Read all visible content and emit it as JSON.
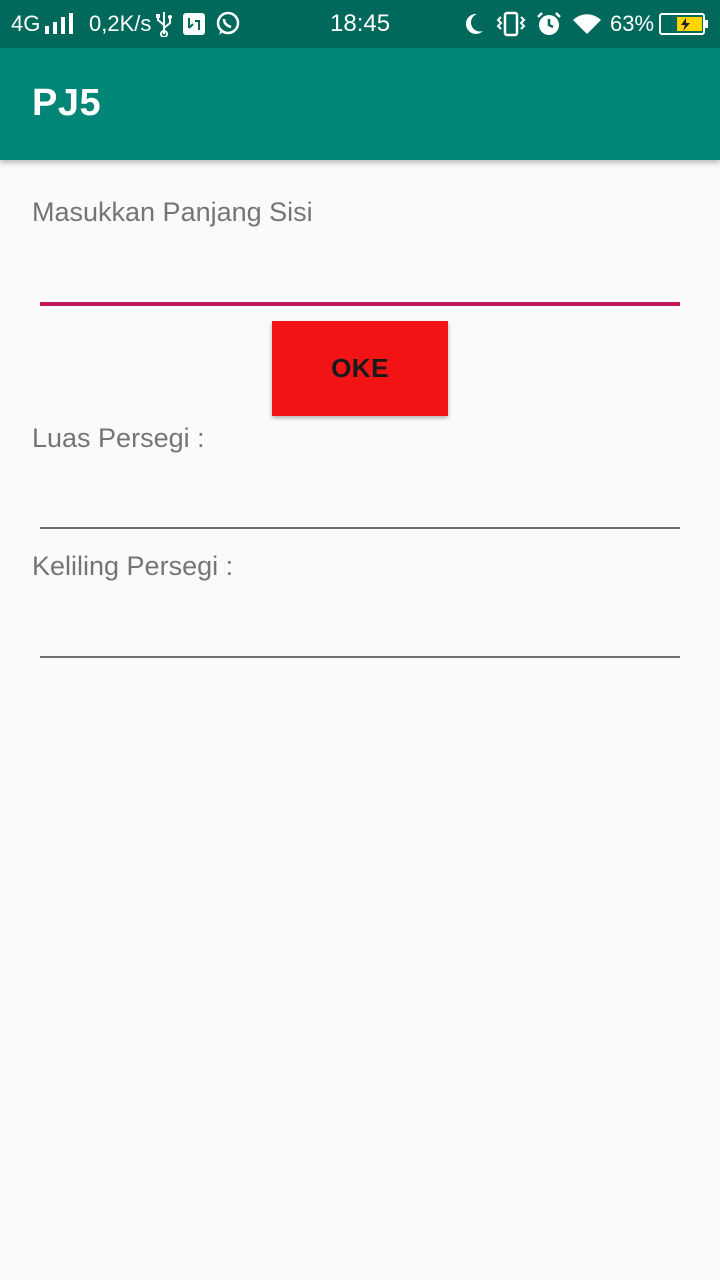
{
  "status_bar": {
    "network": "4G",
    "speed": "0,2K/s",
    "time": "18:45",
    "battery": "63%",
    "icons": [
      "signal-icon",
      "usb-icon",
      "usb-debug-icon",
      "whatsapp-icon",
      "moon-icon",
      "vibrate-icon",
      "alarm-icon",
      "wifi-icon",
      "battery-charging-icon"
    ]
  },
  "app_bar": {
    "title": "PJ5"
  },
  "form": {
    "side_label": "Masukkan Panjang Sisi",
    "side_value": "",
    "ok_label": "OKE",
    "area_label": "Luas Persegi :",
    "area_value": "",
    "perimeter_label": "Keliling Persegi :",
    "perimeter_value": ""
  },
  "colors": {
    "status_bar": "#00695c",
    "app_bar": "#008577",
    "accent_underline": "#c2185b",
    "button": "#f21414"
  }
}
